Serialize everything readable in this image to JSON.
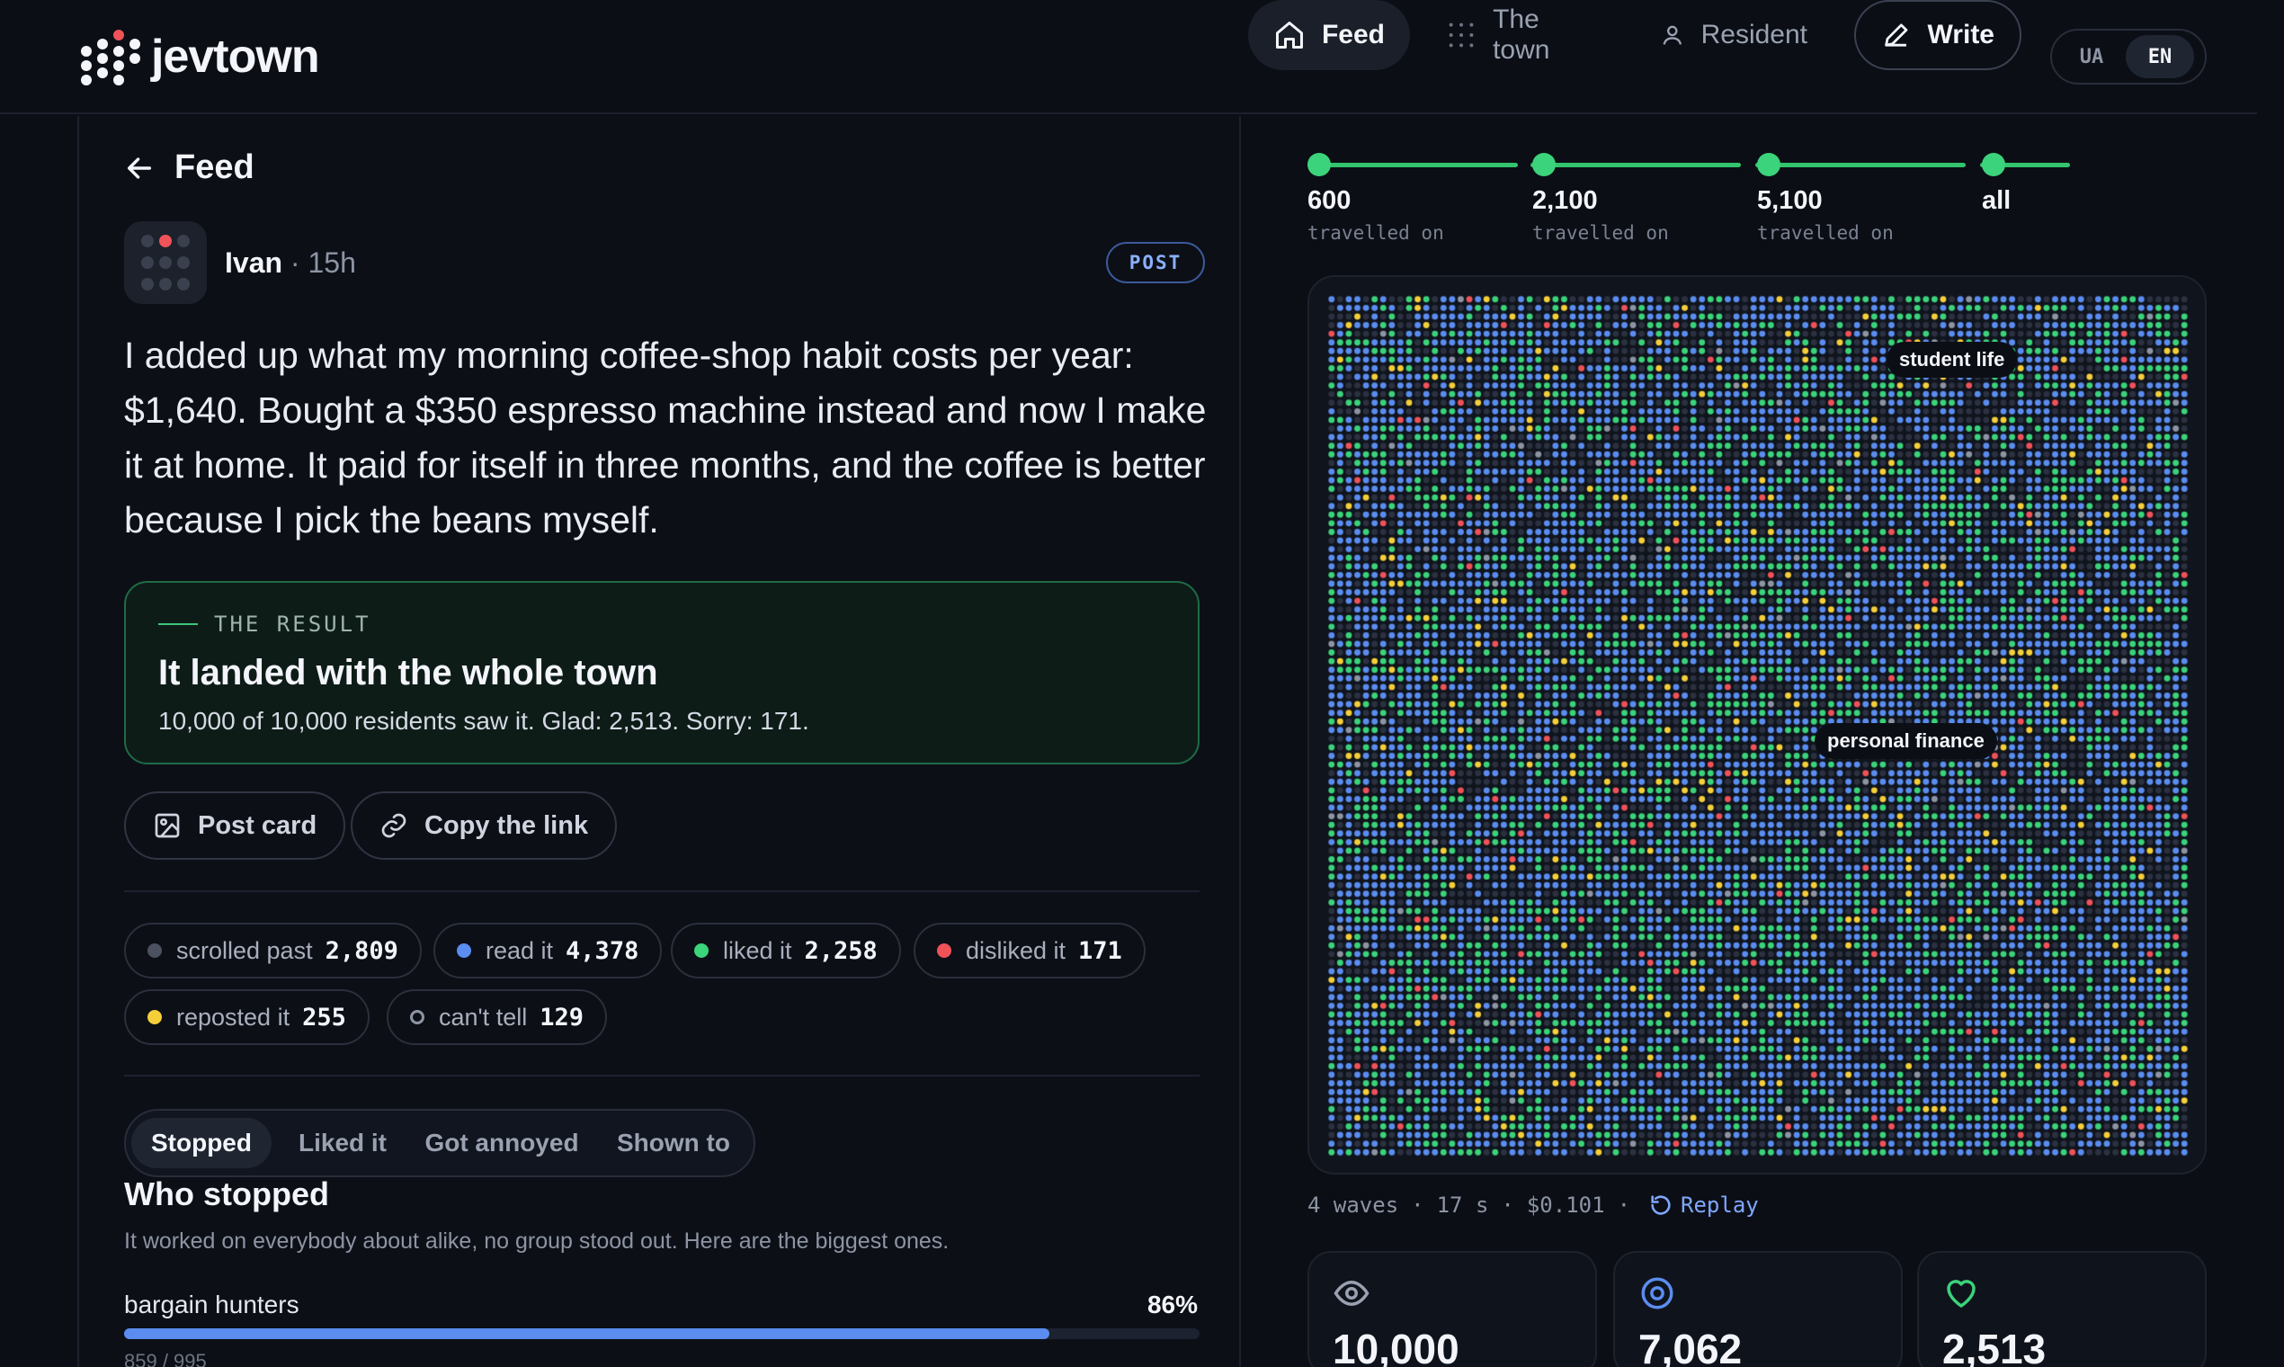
{
  "app": {
    "name": "jevtown"
  },
  "nav": {
    "feed": "Feed",
    "town": "The town",
    "resident": "Resident",
    "write": "Write",
    "lang_ua": "UA",
    "lang_en": "EN",
    "active": "EN"
  },
  "post": {
    "back_label": "Feed",
    "author": "Ivan",
    "separator": "·",
    "time": "15h",
    "badge": "POST",
    "body": "I added up what my morning coffee-shop habit costs per year: $1,640. Bought a $350 espresso machine instead and now I make it at home. It paid for itself in three months, and the coffee is better because I pick the beans myself."
  },
  "result": {
    "kicker": "THE RESULT",
    "title": "It landed with the whole town",
    "summary": "10,000 of 10,000 residents saw it. Glad: 2,513. Sorry: 171."
  },
  "actions": {
    "post_card": "Post card",
    "copy_link": "Copy the link"
  },
  "reactions": [
    {
      "label": "scrolled past",
      "value": "2,809",
      "color": "#4b5160",
      "hollow": false
    },
    {
      "label": "read it",
      "value": "4,378",
      "color": "#5b8df0",
      "hollow": false
    },
    {
      "label": "liked it",
      "value": "2,258",
      "color": "#3bd37b",
      "hollow": false
    },
    {
      "label": "disliked it",
      "value": "171",
      "color": "#f0525a",
      "hollow": false
    },
    {
      "label": "reposted it",
      "value": "255",
      "color": "#f5cf3a",
      "hollow": false
    },
    {
      "label": "can't tell",
      "value": "129",
      "color": "#8d94a3",
      "hollow": true
    }
  ],
  "tabs": {
    "items": [
      "Stopped",
      "Liked it",
      "Got annoyed",
      "Shown to"
    ],
    "active": 0
  },
  "who": {
    "title": "Who stopped",
    "subtitle": "It worked on everybody about alike, no group stood out. Here are the biggest ones.",
    "bars": [
      {
        "label": "bargain hunters",
        "percent_label": "86%",
        "fraction": 0.86,
        "count": "859 / 995"
      }
    ]
  },
  "timeline": [
    {
      "value": "600",
      "caption": "travelled on"
    },
    {
      "value": "2,100",
      "caption": "travelled on"
    },
    {
      "value": "5,100",
      "caption": "travelled on"
    },
    {
      "value": "all",
      "caption": ""
    }
  ],
  "town_map": {
    "tags": [
      "student life",
      "personal finance"
    ],
    "dot_colors": {
      "idle": "#2b3140",
      "read": "#5b8df0",
      "liked": "#3bd37b",
      "disliked": "#f0525a",
      "reposted": "#f5cf3a",
      "cant_tell": "#8d94a3"
    }
  },
  "run_meta": {
    "waves": "4 waves",
    "duration": "17 s",
    "cost": "$0.101",
    "sep": "·",
    "replay": "Replay"
  },
  "stats": [
    {
      "icon": "eye-icon",
      "value": "10,000",
      "color": "#9aa1b0"
    },
    {
      "icon": "target-icon",
      "value": "7,062",
      "color": "#5b8df0"
    },
    {
      "icon": "heart-icon",
      "value": "2,513",
      "color": "#3bd37b"
    }
  ],
  "colors": {
    "accent_green": "#3bd37b",
    "accent_blue": "#5b8df0",
    "background": "#0b0e15"
  }
}
